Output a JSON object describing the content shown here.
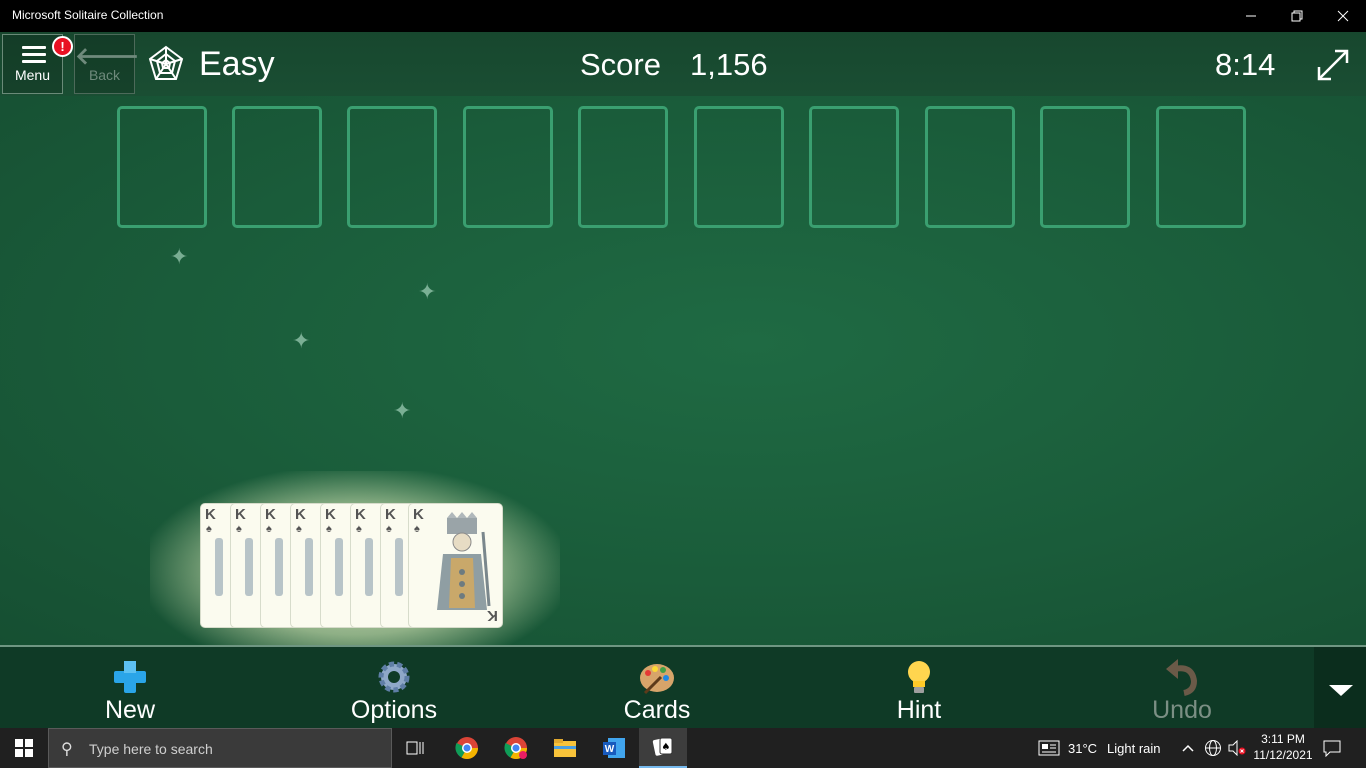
{
  "window": {
    "title": "Microsoft Solitaire Collection",
    "controls": [
      "minimize",
      "restore",
      "close"
    ]
  },
  "header": {
    "menu_label": "Menu",
    "menu_alert": "!",
    "back_label": "Back",
    "difficulty": "Easy",
    "score_label": "Score",
    "score_value": "1,156",
    "timer": "8:14"
  },
  "board": {
    "foundation_slots": 10,
    "stack": {
      "ranks": [
        "K",
        "K",
        "K",
        "K",
        "K",
        "K",
        "K",
        "K"
      ],
      "suit": "spades"
    }
  },
  "toolbar": {
    "new_label": "New",
    "options_label": "Options",
    "cards_label": "Cards",
    "hint_label": "Hint",
    "undo_label": "Undo"
  },
  "taskbar": {
    "search_placeholder": "Type here to search",
    "weather_temp": "31°C",
    "weather_desc": "Light rain",
    "time": "3:11 PM",
    "date": "11/12/2021"
  },
  "colors": {
    "felt": "#1a5c3a",
    "slot_border": "#3a9f70",
    "toolbar_bg": "#0f3a26",
    "alert": "#e81123"
  }
}
